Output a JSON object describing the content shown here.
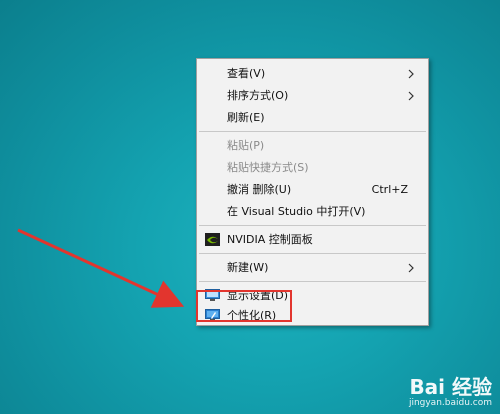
{
  "menu": {
    "items": [
      {
        "label": "查看(V)",
        "submenu": true
      },
      {
        "label": "排序方式(O)",
        "submenu": true
      },
      {
        "label": "刷新(E)"
      },
      {
        "label": "粘贴(P)",
        "disabled": true
      },
      {
        "label": "粘贴快捷方式(S)",
        "disabled": true
      },
      {
        "label": "撤消 删除(U)",
        "shortcut": "Ctrl+Z"
      },
      {
        "label": "在 Visual Studio 中打开(V)"
      },
      {
        "label": "NVIDIA 控制面板",
        "icon": "nvidia-icon"
      },
      {
        "label": "新建(W)",
        "submenu": true
      },
      {
        "label": "显示设置(D)",
        "icon": "display-icon"
      },
      {
        "label": "个性化(R)",
        "icon": "personalize-icon"
      }
    ]
  },
  "watermark": {
    "brand": "Bai 经验",
    "url": "jingyan.baidu.com"
  },
  "colors": {
    "desktop": "#1aa6b4",
    "highlight": "#e2352e",
    "menu_bg": "#f2f2f2"
  }
}
